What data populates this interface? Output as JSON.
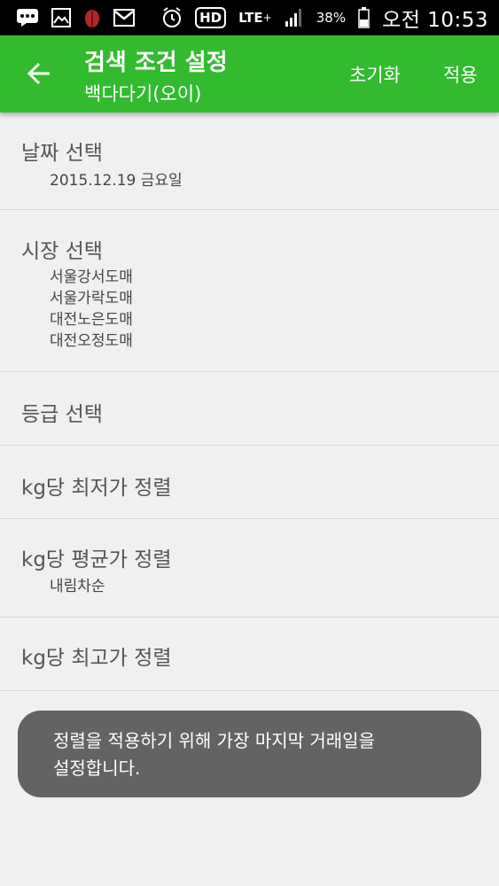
{
  "status_bar": {
    "lte_label": "LTE",
    "hd_label": "HD",
    "battery_percent": "38%",
    "time": "오전 10:53",
    "left_icons": [
      "message-icon",
      "image-icon",
      "ladybug-icon",
      "gmail-icon"
    ],
    "right_icons": [
      "alarm-icon",
      "hd-call-icon",
      "lte-icon",
      "signal-icon",
      "battery-icon"
    ]
  },
  "app_bar": {
    "title": "검색 조건 설정",
    "subtitle": "백다다기(오이)",
    "reset_label": "초기화",
    "apply_label": "적용",
    "background_color": "#33bb2f"
  },
  "settings": {
    "date": {
      "title": "날짜 선택",
      "values": [
        "2015.12.19 금요일"
      ]
    },
    "market": {
      "title": "시장 선택",
      "values": [
        "서울강서도매",
        "서울가락도매",
        "대전노은도매",
        "대전오정도매"
      ]
    },
    "grade": {
      "title": "등급 선택"
    },
    "min_price_sort": {
      "title": "kg당 최저가 정렬"
    },
    "avg_price_sort": {
      "title": "kg당 평균가 정렬",
      "values": [
        "내림차순"
      ]
    },
    "max_price_sort": {
      "title": "kg당 최고가 정렬"
    }
  },
  "toast": {
    "line1": "정렬을 적용하기 위해 가장 마지막 거래일을",
    "line2": "설정합니다."
  }
}
